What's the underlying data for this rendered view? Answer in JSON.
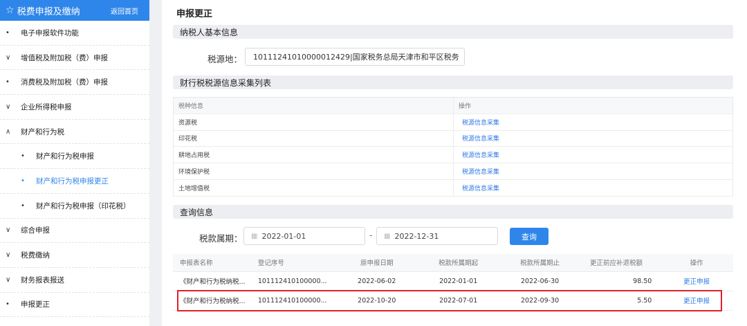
{
  "sidebar": {
    "title": "税费申报及缴纳",
    "back_label": "返回首页",
    "items": [
      {
        "mark": "•",
        "label": "电子申报软件功能"
      },
      {
        "mark": "∨",
        "label": "增值税及附加税（费）申报"
      },
      {
        "mark": "•",
        "label": "消费税及附加税（费）申报"
      },
      {
        "mark": "∨",
        "label": "企业所得税申报"
      },
      {
        "mark": "∧",
        "label": "财产和行为税"
      },
      {
        "mark": "•",
        "label": "财产和行为税申报"
      },
      {
        "mark": "•",
        "label": "财产和行为税申报更正"
      },
      {
        "mark": "•",
        "label": "财产和行为税申报（印花税）"
      },
      {
        "mark": "∨",
        "label": "综合申报"
      },
      {
        "mark": "∨",
        "label": "税费缴纳"
      },
      {
        "mark": "∨",
        "label": "财务报表报送"
      },
      {
        "mark": "•",
        "label": "申报更正"
      }
    ]
  },
  "main": {
    "page_title": "申报更正",
    "section_basic": "纳税人基本信息",
    "tax_source_label": "税源地：",
    "tax_source_value": "10111241010000012429|国家税务总局天津市和平区税务",
    "section_collect": "财行税税源信息采集列表",
    "collect_table": {
      "headers": [
        "税种信息",
        "操作"
      ],
      "rows": [
        {
          "name": "资源税",
          "action": "税源信息采集"
        },
        {
          "name": "印花税",
          "action": "税源信息采集"
        },
        {
          "name": "耕地占用税",
          "action": "税源信息采集"
        },
        {
          "name": "环境保护税",
          "action": "税源信息采集"
        },
        {
          "name": "土地增值税",
          "action": "税源信息采集"
        }
      ]
    },
    "section_query": "查询信息",
    "period_label": "税款属期：",
    "date_start": "2022-01-01",
    "date_end": "2022-12-31",
    "date_separator": "-",
    "query_button": "查询",
    "result_table": {
      "headers": [
        "申报表名称",
        "登记序号",
        "原申报日期",
        "税款所属期起",
        "税款所属期止",
        "更正前应补退税额",
        "操作"
      ],
      "rows": [
        {
          "name": "《财产和行为税纳税...",
          "reg": "101112410100000...",
          "date": "2022-06-02",
          "start": "2022-01-01",
          "end": "2022-06-30",
          "amount": "98.50",
          "action": "更正申报"
        },
        {
          "name": "《财产和行为税纳税...",
          "reg": "101112410100000...",
          "date": "2022-10-20",
          "start": "2022-07-01",
          "end": "2022-09-30",
          "amount": "5.50",
          "action": "更正申报"
        }
      ]
    }
  },
  "colors": {
    "accent": "#2f86ea",
    "highlight": "#e0202a",
    "link": "#2f7ae5"
  }
}
